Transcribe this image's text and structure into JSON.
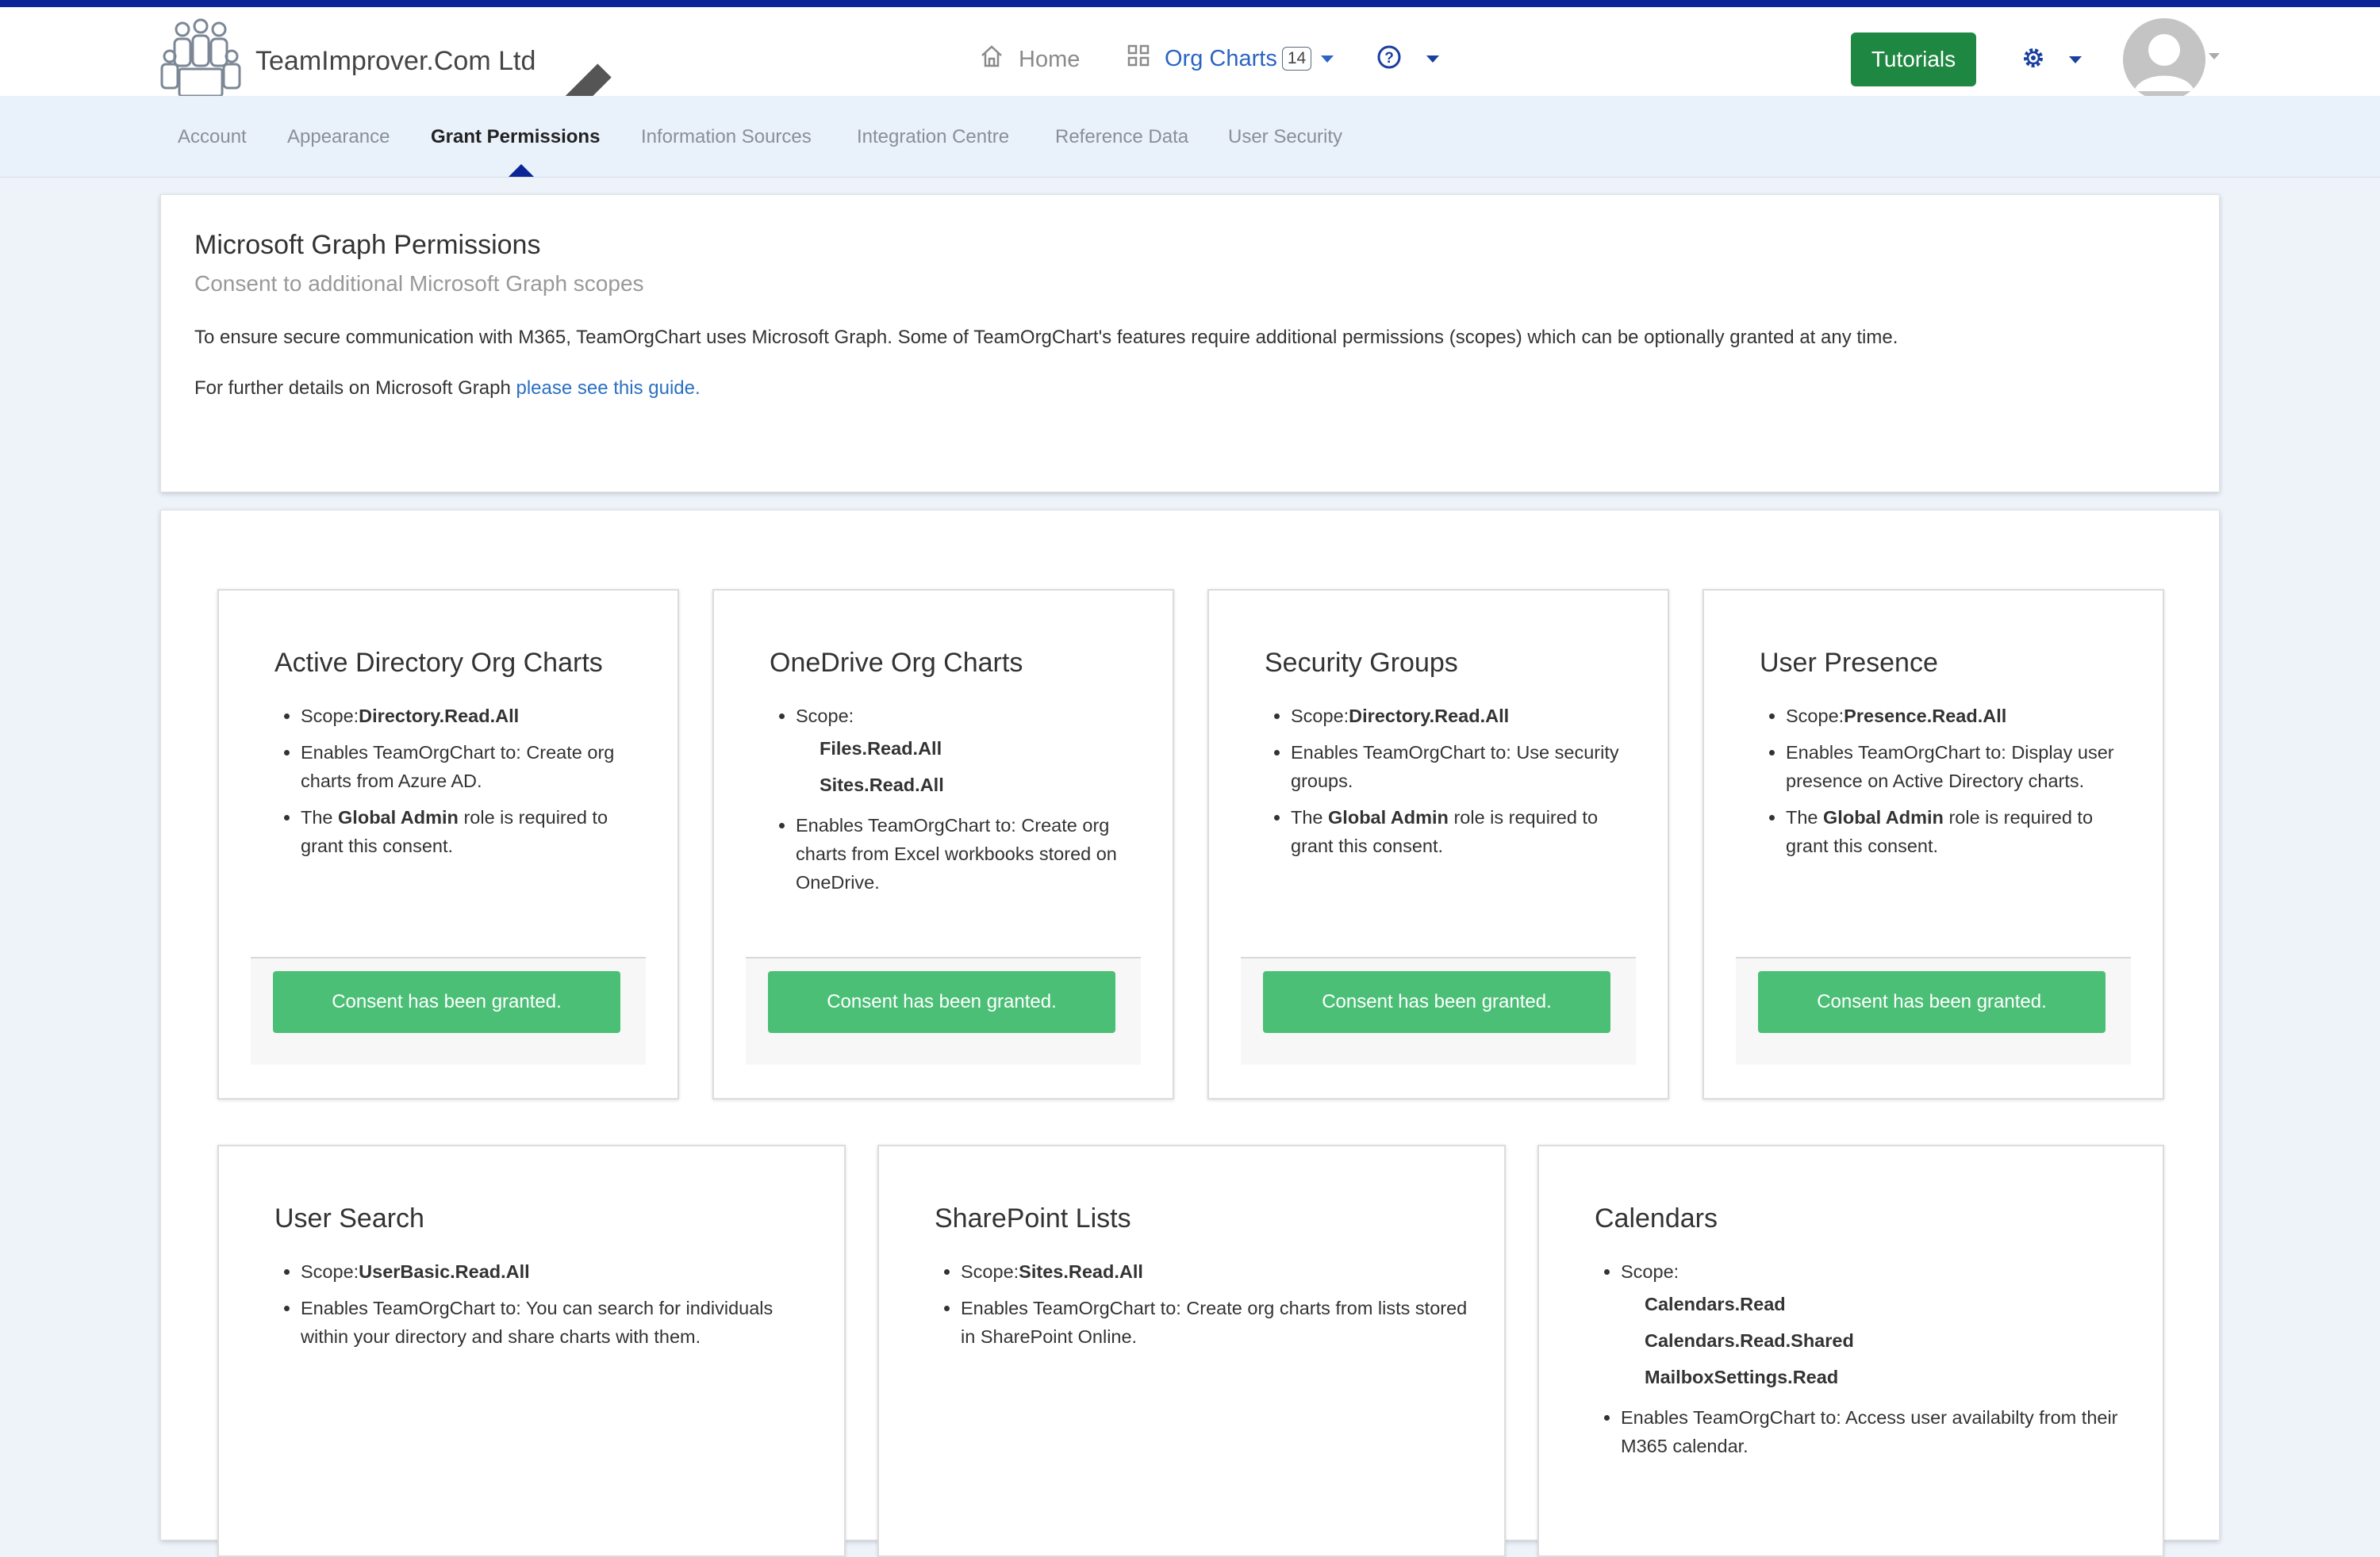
{
  "header": {
    "company_name": "TeamImprover.Com Ltd",
    "home_label": "Home",
    "org_charts_label": "Org Charts",
    "org_charts_count": "14",
    "tutorials_label": "Tutorials"
  },
  "subnav": {
    "items": [
      "Account",
      "Appearance",
      "Grant Permissions",
      "Information Sources",
      "Integration Centre",
      "Reference Data",
      "User Security"
    ],
    "active": "Grant Permissions"
  },
  "intro": {
    "title": "Microsoft Graph Permissions",
    "subtitle": "Consent to additional Microsoft Graph scopes",
    "paragraph": "To ensure secure communication with M365, TeamOrgChart uses Microsoft Graph. Some of TeamOrgChart's features require additional permissions (scopes) which can be optionally granted at any time.",
    "details_prefix": "For further details on Microsoft Graph ",
    "details_link": "please see this guide."
  },
  "cards": [
    {
      "title": "Active Directory Org Charts",
      "scope_label": "Scope:",
      "scope": "Directory.Read.All",
      "enables": "Enables TeamOrgChart to: Create org charts from Azure AD.",
      "role_prefix": "The ",
      "role": "Global Admin",
      "role_suffix": " role is required to grant this consent.",
      "button": "Consent has been granted."
    },
    {
      "title": "OneDrive Org Charts",
      "scope_label": "Scope:",
      "scopes": [
        "Files.Read.All",
        "Sites.Read.All"
      ],
      "enables": "Enables TeamOrgChart to: Create org charts from Excel workbooks stored on OneDrive.",
      "button": "Consent has been granted."
    },
    {
      "title": "Security Groups",
      "scope_label": "Scope:",
      "scope": "Directory.Read.All",
      "enables": "Enables TeamOrgChart to: Use security groups.",
      "role_prefix": "The ",
      "role": "Global Admin",
      "role_suffix": " role is required to grant this consent.",
      "button": "Consent has been granted."
    },
    {
      "title": "User Presence",
      "scope_label": "Scope:",
      "scope": "Presence.Read.All",
      "enables": "Enables TeamOrgChart to: Display user presence on Active Directory charts.",
      "role_prefix": "The ",
      "role": "Global Admin",
      "role_suffix": " role is required to grant this consent.",
      "button": "Consent has been granted."
    },
    {
      "title": "User Search",
      "scope_label": "Scope:",
      "scope": "UserBasic.Read.All",
      "enables": "Enables TeamOrgChart to: You can search for individuals within your directory and share charts with them."
    },
    {
      "title": "SharePoint Lists",
      "scope_label": "Scope:",
      "scope": "Sites.Read.All",
      "enables": "Enables TeamOrgChart to: Create org charts from lists stored in SharePoint Online."
    },
    {
      "title": "Calendars",
      "scope_label": "Scope:",
      "scopes": [
        "Calendars.Read",
        "Calendars.Read.Shared",
        "MailboxSettings.Read"
      ],
      "enables": "Enables TeamOrgChart to: Access user availabilty from their M365 calendar."
    }
  ],
  "colors": {
    "accent": "#0b2597",
    "link": "#2a6fc2",
    "tutorials_bg": "#1e8741",
    "consent_bg": "#4cbf77"
  },
  "icons": [
    "team-logo-icon",
    "pencil-icon",
    "home-icon",
    "grid-icon",
    "help-circle-icon",
    "gear-icon",
    "user-avatar-icon"
  ]
}
